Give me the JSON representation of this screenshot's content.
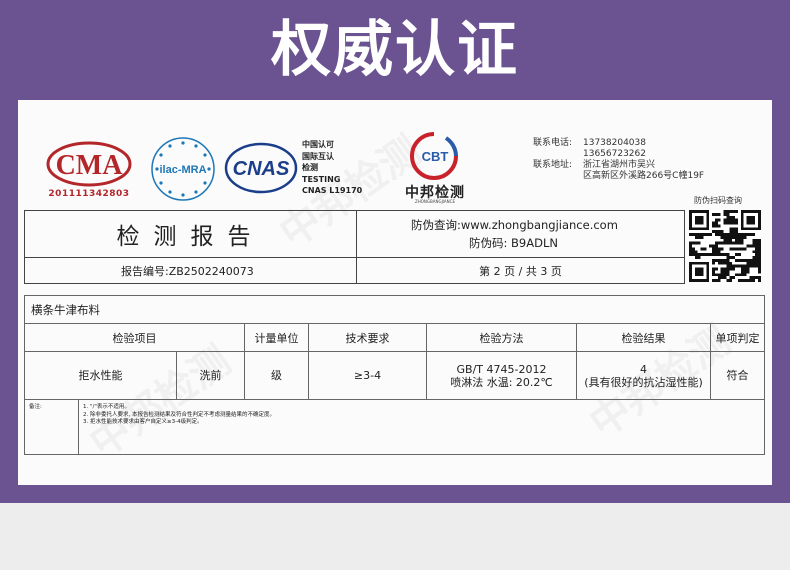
{
  "banner": {
    "title": "权威认证"
  },
  "colors": {
    "banner": "#6a5390",
    "cma_red": "#b3262a",
    "ilac_blue": "#1c77b6",
    "cnas_navy": "#1a3e8a",
    "cbt_red": "#c8232b",
    "cbt_blue": "#2a5caa"
  },
  "logos": {
    "cma": {
      "mark": "CMA",
      "code": "201111342803",
      "icon": "cma-seal-icon"
    },
    "ilac": {
      "mark": "ilac-MRA",
      "icon": "ilac-mra-icon"
    },
    "cnas": {
      "mark": "CNAS",
      "icon": "cnas-logo-icon"
    },
    "cert_lines": [
      "中国认可",
      "国际互认",
      "检测",
      "TESTING",
      "CNAS L19170"
    ],
    "cbt": {
      "mark": "CBT",
      "name": "中邦检测",
      "sub": "ZHONGBANGJIANCE",
      "icon": "cbt-globe-icon"
    }
  },
  "contact": {
    "phone_label": "联系电话:",
    "phones": [
      "13738204038",
      "13656723262"
    ],
    "address_label": "联系地址:",
    "address_lines": [
      "浙江省湖州市吴兴",
      "区高新区外溪路266号C幢19F"
    ]
  },
  "qr": {
    "caption": "防伪扫码查询",
    "icon": "qr-code-icon"
  },
  "report": {
    "title": "检测报告",
    "query_label": "防伪查询:",
    "query_url": "www.zhongbangjiance.com",
    "code_label": "防伪码:",
    "code": "B9ADLN",
    "report_no_label": "报告编号:",
    "report_no": "ZB2502240073",
    "page_info": "第 2 页 / 共 3 页"
  },
  "table": {
    "fabric": "横条牛津布料",
    "headers": [
      "检验项目",
      "计量单位",
      "技术要求",
      "检验方法",
      "检验结果",
      "单项判定"
    ],
    "row": {
      "item": "拒水性能",
      "condition": "洗前",
      "unit": "级",
      "requirement": "≥3-4",
      "method_line1": "GB/T 4745-2012",
      "method_line2": "喷淋法 水温: 20.2℃",
      "result_value": "4",
      "result_desc": "(具有很好的抗沾湿性能)",
      "verdict": "符合"
    },
    "notes_label": "备注:",
    "notes": [
      "1. \"/\"表示不适用。",
      "2. 除非委托人要求, 本报告检测结果及符合性判定不考虑测量结果的不确定度。",
      "3. 拒水性能技术要求由客户自定义≥3-4级判定。"
    ]
  },
  "watermark": "中邦检测"
}
